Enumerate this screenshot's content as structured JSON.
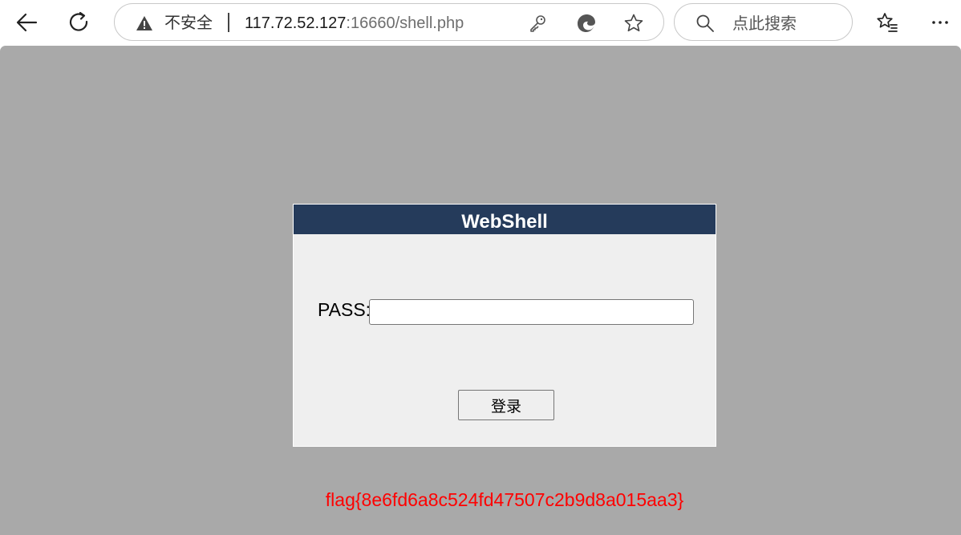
{
  "browser": {
    "address_bar": {
      "security_label": "不安全",
      "url_host": "117.72.52.127",
      "url_rest": ":16660/shell.php"
    },
    "search": {
      "placeholder": "点此搜索"
    },
    "icons": {
      "back": "arrow-left-icon",
      "refresh": "refresh-icon",
      "warning": "warning-triangle-icon",
      "key": "key-icon",
      "edge": "edge-logo-icon",
      "favorite": "star-icon",
      "search": "magnifier-icon",
      "favorites_list": "star-list-icon",
      "more": "more-dots-icon"
    }
  },
  "page": {
    "login": {
      "title": "WebShell",
      "pass_label": "PASS:",
      "pass_value": "",
      "submit_label": "登录"
    },
    "flag": "flag{8e6fd6a8c524fd47507c2b9d8a015aa3}"
  },
  "colors": {
    "page_background": "#a9a9a9",
    "title_bar": "#253b5b",
    "login_panel": "#efefef",
    "flag_text": "#ff0000"
  }
}
